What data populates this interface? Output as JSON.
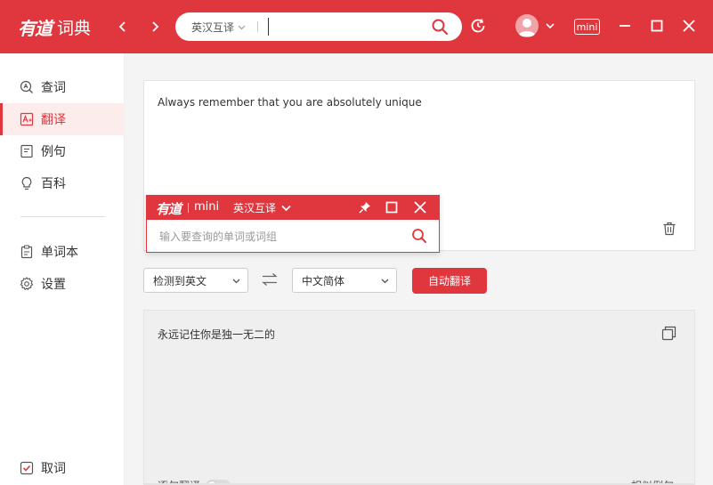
{
  "app": {
    "brand": "有道",
    "name": "词典"
  },
  "search": {
    "mode": "英汉互译",
    "value": ""
  },
  "header": {
    "mini_label": "mini"
  },
  "sidebar": {
    "items": [
      {
        "label": "查词",
        "icon": "search-doc-icon"
      },
      {
        "label": "翻译",
        "icon": "translate-icon",
        "active": true
      },
      {
        "label": "例句",
        "icon": "document-icon"
      },
      {
        "label": "百科",
        "icon": "lightbulb-icon"
      },
      {
        "label": "单词本",
        "icon": "clipboard-icon"
      },
      {
        "label": "设置",
        "icon": "gear-icon"
      }
    ],
    "bottom": {
      "label": "取词",
      "checked": true
    }
  },
  "translate": {
    "source_text": "Always remember that you are absolutely unique",
    "source_lang": "检测到英文",
    "target_lang": "中文简体",
    "button_label": "自动翻译",
    "result_text": "永远记住你是独一无二的",
    "word_translate_label": "逐句翻译",
    "similar_label": "相似例句"
  },
  "mini_window": {
    "brand": "有道",
    "title": "mini",
    "mode": "英汉互译",
    "placeholder": "输入要查询的单词或词组"
  },
  "colors": {
    "accent": "#e0373e"
  }
}
